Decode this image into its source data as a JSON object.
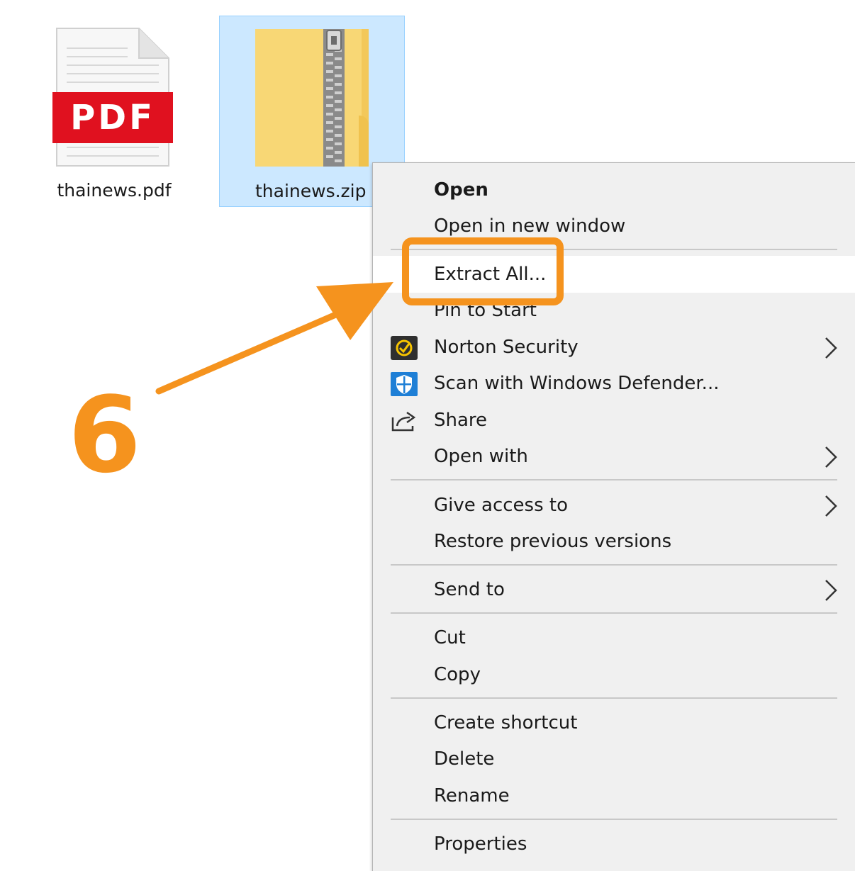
{
  "desktop": {
    "files": [
      {
        "name": "thainews.pdf",
        "icon": "pdf-file-icon",
        "selected": false,
        "badge": "PDF"
      },
      {
        "name": "thainews.zip",
        "icon": "zip-folder-icon",
        "selected": true
      }
    ]
  },
  "context_menu": {
    "items": [
      {
        "label": "Open",
        "bold": true
      },
      {
        "label": "Open in new window"
      },
      {
        "label": "Extract All...",
        "highlighted": true
      },
      {
        "label": "Pin to Start"
      },
      {
        "label": "Norton Security",
        "icon": "norton-icon",
        "submenu": true
      },
      {
        "label": "Scan with Windows Defender...",
        "icon": "windows-defender-icon"
      },
      {
        "label": "Share",
        "icon": "share-icon"
      },
      {
        "label": "Open with",
        "submenu": true
      },
      {
        "label": "Give access to",
        "submenu": true
      },
      {
        "label": "Restore previous versions"
      },
      {
        "label": "Send to",
        "submenu": true
      },
      {
        "label": "Cut"
      },
      {
        "label": "Copy"
      },
      {
        "label": "Create shortcut"
      },
      {
        "label": "Delete"
      },
      {
        "label": "Rename"
      },
      {
        "label": "Properties"
      }
    ]
  },
  "annotation": {
    "step_number": "6",
    "color": "#f5931e",
    "target": "Extract All..."
  },
  "colors": {
    "selection_bg": "#cce8ff",
    "selection_border": "#99d1ff",
    "menu_bg": "#f0f0f0",
    "pdf_red": "#e0111f",
    "folder_yellow": "#f8d775"
  }
}
